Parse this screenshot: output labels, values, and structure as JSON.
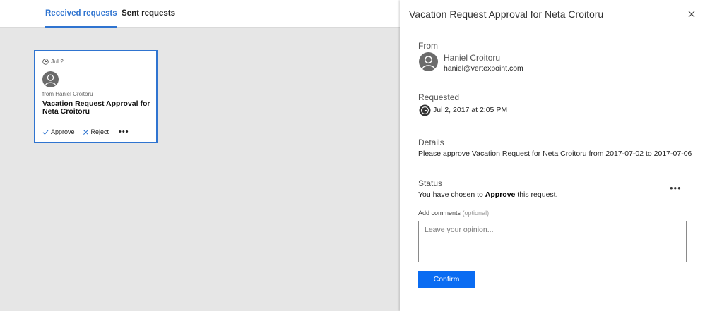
{
  "tabs": [
    {
      "label": "Received requests",
      "active": true
    },
    {
      "label": "Sent requests",
      "active": false
    }
  ],
  "card": {
    "date": "Jul 2",
    "from": "from Haniel Croitoru",
    "title": "Vacation Request Approval for Neta Croitoru",
    "approve_label": "Approve",
    "reject_label": "Reject",
    "more_label": "•••"
  },
  "panel": {
    "title": "Vacation Request Approval for Neta Croitoru",
    "from_label": "From",
    "from_name": "Haniel Croitoru",
    "from_email": "haniel@vertexpoint.com",
    "requested_label": "Requested",
    "requested_date": "Jul 2, 2017 at 2:05 PM",
    "details_label": "Details",
    "details_text": "Please approve Vacation Request for Neta Croitoru from 2017-07-02 to 2017-07-06",
    "status_label": "Status",
    "status_prefix": "You have chosen to ",
    "status_choice": "Approve",
    "status_suffix": " this request.",
    "more_label": "•••",
    "comments_label": "Add comments",
    "comments_optional": "(optional)",
    "comments_placeholder": "Leave your opinion...",
    "comments_value": "",
    "confirm_label": "Confirm"
  },
  "colors": {
    "accent": "#2f74d0",
    "button": "#0a6cf2",
    "background": "#e6e6e6"
  },
  "icons": [
    "clock-icon",
    "avatar-icon",
    "check-icon",
    "x-icon",
    "more-icon",
    "close-icon"
  ]
}
